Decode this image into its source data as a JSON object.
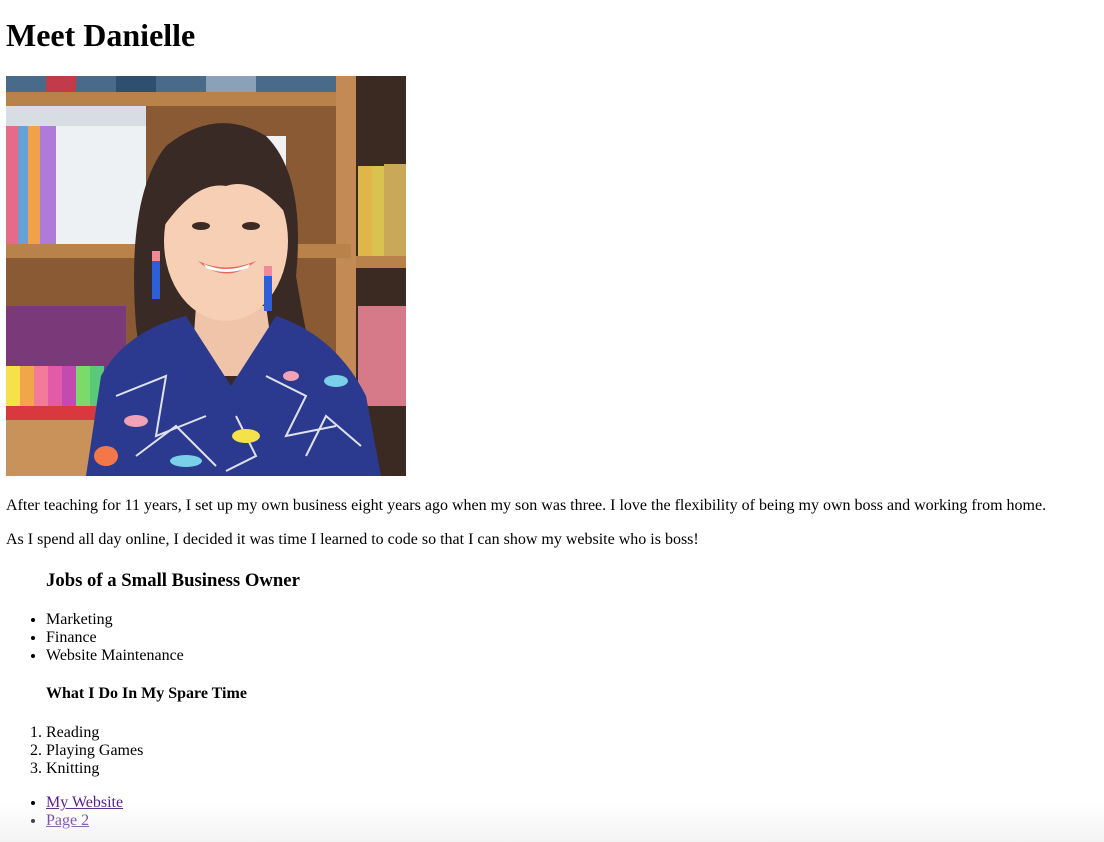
{
  "header": {
    "title": "Meet Danielle"
  },
  "photo": {
    "subject": "portrait-photo"
  },
  "intro": {
    "paragraph1": "After teaching for 11 years, I set up my own business eight years ago when my son was three. I love the flexibility of being my own boss and working from home.",
    "paragraph2": "As I spend all day online, I decided it was time I learned to code so that I can show my website who is boss!"
  },
  "jobs": {
    "heading": "Jobs of a Small Business Owner",
    "items": [
      "Marketing",
      "Finance",
      "Website Maintenance"
    ]
  },
  "spare_time": {
    "heading": "What I Do In My Spare Time",
    "items": [
      "Reading",
      "Playing Games",
      "Knitting"
    ]
  },
  "links": {
    "items": [
      "My Website",
      "Page 2"
    ]
  },
  "colors": {
    "visited_link": "#551a8b",
    "text": "#000000",
    "background": "#ffffff"
  }
}
